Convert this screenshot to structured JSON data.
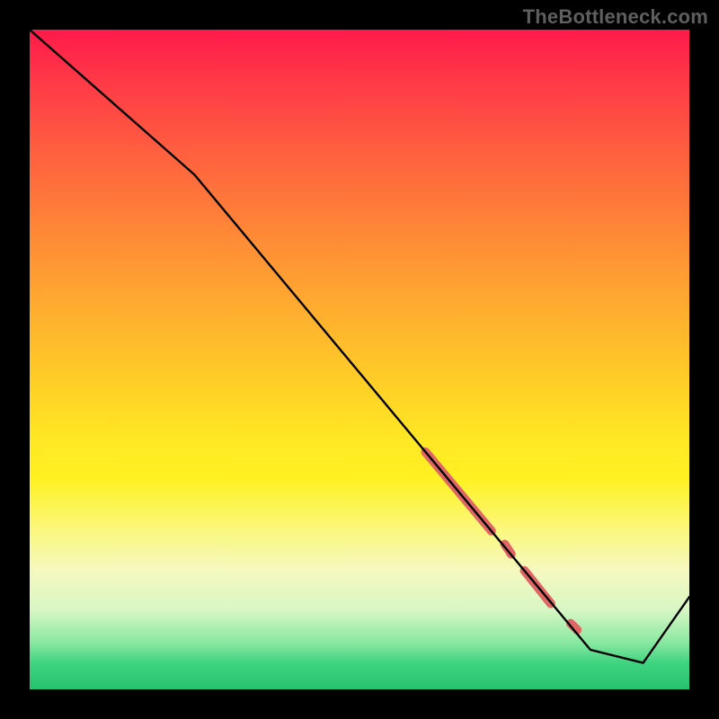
{
  "watermark": "TheBottleneck.com",
  "chart_data": {
    "type": "line",
    "title": "",
    "xlabel": "",
    "ylabel": "",
    "xlim": [
      0,
      100
    ],
    "ylim": [
      0,
      100
    ],
    "series": [
      {
        "name": "curve",
        "x": [
          0,
          25,
          85,
          93,
          100
        ],
        "values": [
          100,
          78,
          6,
          4,
          14
        ]
      }
    ],
    "markers": [
      {
        "name": "highlight-a",
        "x0": 60,
        "y0": 36,
        "x1": 70,
        "y1": 24,
        "color": "#e06666",
        "width": 10
      },
      {
        "name": "highlight-b",
        "x0": 72,
        "y0": 22,
        "x1": 73,
        "y1": 20.5,
        "color": "#e06666",
        "width": 10
      },
      {
        "name": "highlight-c",
        "x0": 75,
        "y0": 18,
        "x1": 79,
        "y1": 13,
        "color": "#e06666",
        "width": 10
      },
      {
        "name": "highlight-d",
        "x0": 82,
        "y0": 10,
        "x1": 83,
        "y1": 9,
        "color": "#e06666",
        "width": 10
      }
    ],
    "gradient_stops": [
      {
        "pos": 0,
        "color": "#ff1a4a"
      },
      {
        "pos": 20,
        "color": "#ff643e"
      },
      {
        "pos": 44,
        "color": "#ffb22e"
      },
      {
        "pos": 68,
        "color": "#fff122"
      },
      {
        "pos": 88,
        "color": "#d8f7c4"
      },
      {
        "pos": 100,
        "color": "#27c36f"
      }
    ]
  }
}
